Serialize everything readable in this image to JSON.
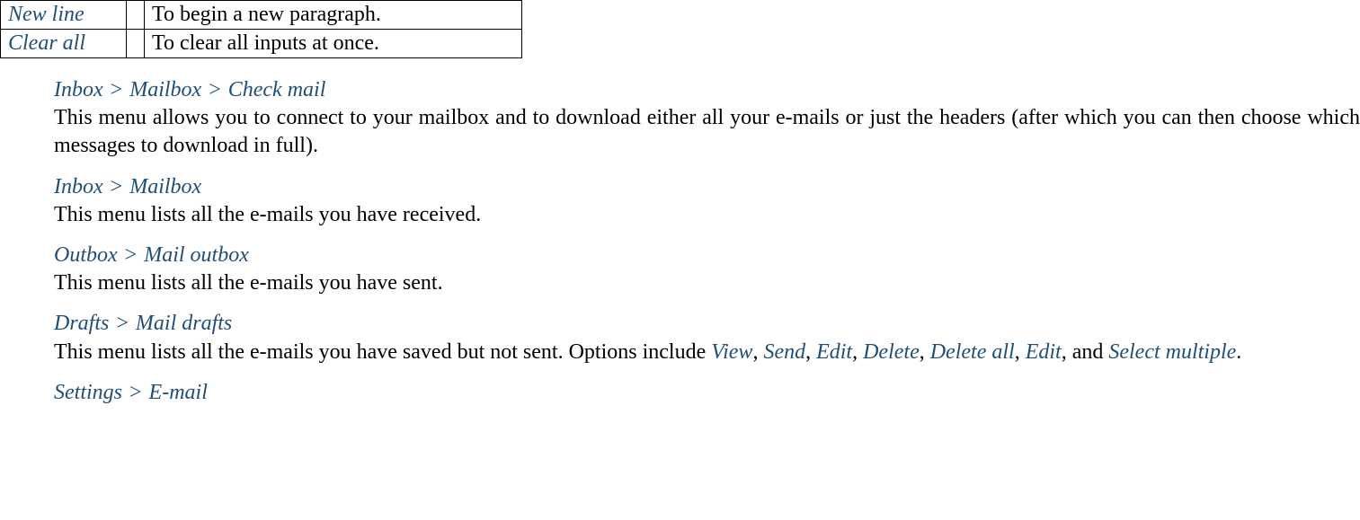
{
  "table": {
    "rows": [
      {
        "command": "New line",
        "description": "To begin a new paragraph."
      },
      {
        "command": "Clear all",
        "description": "To clear all inputs at once."
      }
    ]
  },
  "sections": [
    {
      "breadcrumb": [
        "Inbox",
        "Mailbox",
        "Check mail"
      ],
      "description_parts": [
        {
          "type": "text",
          "value": "This menu allows you to connect to your mailbox and to download either all your e-mails or just the headers (after which you can then choose which messages to download in full)."
        }
      ]
    },
    {
      "breadcrumb": [
        "Inbox",
        "Mailbox"
      ],
      "description_parts": [
        {
          "type": "text",
          "value": "This menu lists all the e-mails you have received."
        }
      ]
    },
    {
      "breadcrumb": [
        "Outbox",
        "Mail outbox"
      ],
      "description_parts": [
        {
          "type": "text",
          "value": "This menu lists all the e-mails you have sent."
        }
      ]
    },
    {
      "breadcrumb": [
        "Drafts",
        "Mail drafts"
      ],
      "description_parts": [
        {
          "type": "text",
          "value": "This menu lists all the e-mails you have saved but not sent. Options include "
        },
        {
          "type": "option",
          "value": "View"
        },
        {
          "type": "text",
          "value": ", "
        },
        {
          "type": "option",
          "value": "Send"
        },
        {
          "type": "text",
          "value": ", "
        },
        {
          "type": "option",
          "value": "Edit"
        },
        {
          "type": "text",
          "value": ", "
        },
        {
          "type": "option",
          "value": "Delete"
        },
        {
          "type": "text",
          "value": ", "
        },
        {
          "type": "option",
          "value": "Delete all"
        },
        {
          "type": "text",
          "value": ", "
        },
        {
          "type": "option",
          "value": "Edit"
        },
        {
          "type": "text",
          "value": ", and "
        },
        {
          "type": "option",
          "value": "Select multiple"
        },
        {
          "type": "text",
          "value": "."
        }
      ]
    },
    {
      "breadcrumb": [
        "Settings",
        "E-mail"
      ],
      "description_parts": []
    }
  ],
  "separator": ">"
}
